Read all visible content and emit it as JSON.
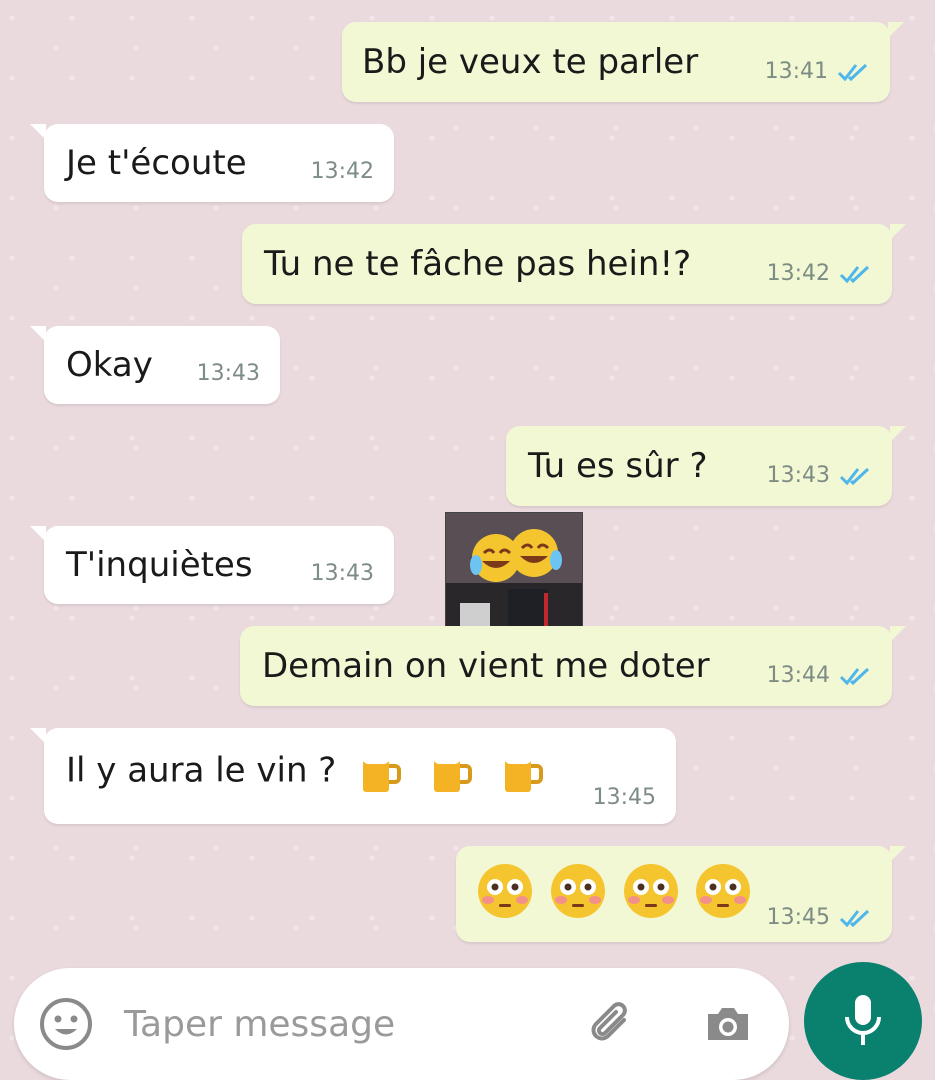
{
  "messages": [
    {
      "text": "Bb je veux te parler",
      "time": "13:41"
    },
    {
      "text": "Je t'écoute",
      "time": "13:42"
    },
    {
      "text": "Tu ne te fâche pas hein!?",
      "time": "13:42"
    },
    {
      "text": "Okay",
      "time": "13:43"
    },
    {
      "text": "Tu es sûr ?",
      "time": "13:43"
    },
    {
      "text": "T'inquiètes",
      "time": "13:43"
    },
    {
      "text": "Demain on vient me doter",
      "time": "13:44"
    },
    {
      "text": "Il y aura le vin ?",
      "time": "13:45"
    },
    {
      "text": "",
      "time": "13:45"
    }
  ],
  "input": {
    "placeholder": "Taper message"
  },
  "icons": {
    "emoji": "smiley-icon",
    "attach": "paperclip-icon",
    "camera": "camera-icon",
    "mic": "microphone-icon",
    "read": "double-check-icon"
  },
  "colors": {
    "outgoing_bubble": "#f2f8d3",
    "incoming_bubble": "#ffffff",
    "read_ticks": "#4fb6ec",
    "mic_button": "#0a806f"
  }
}
